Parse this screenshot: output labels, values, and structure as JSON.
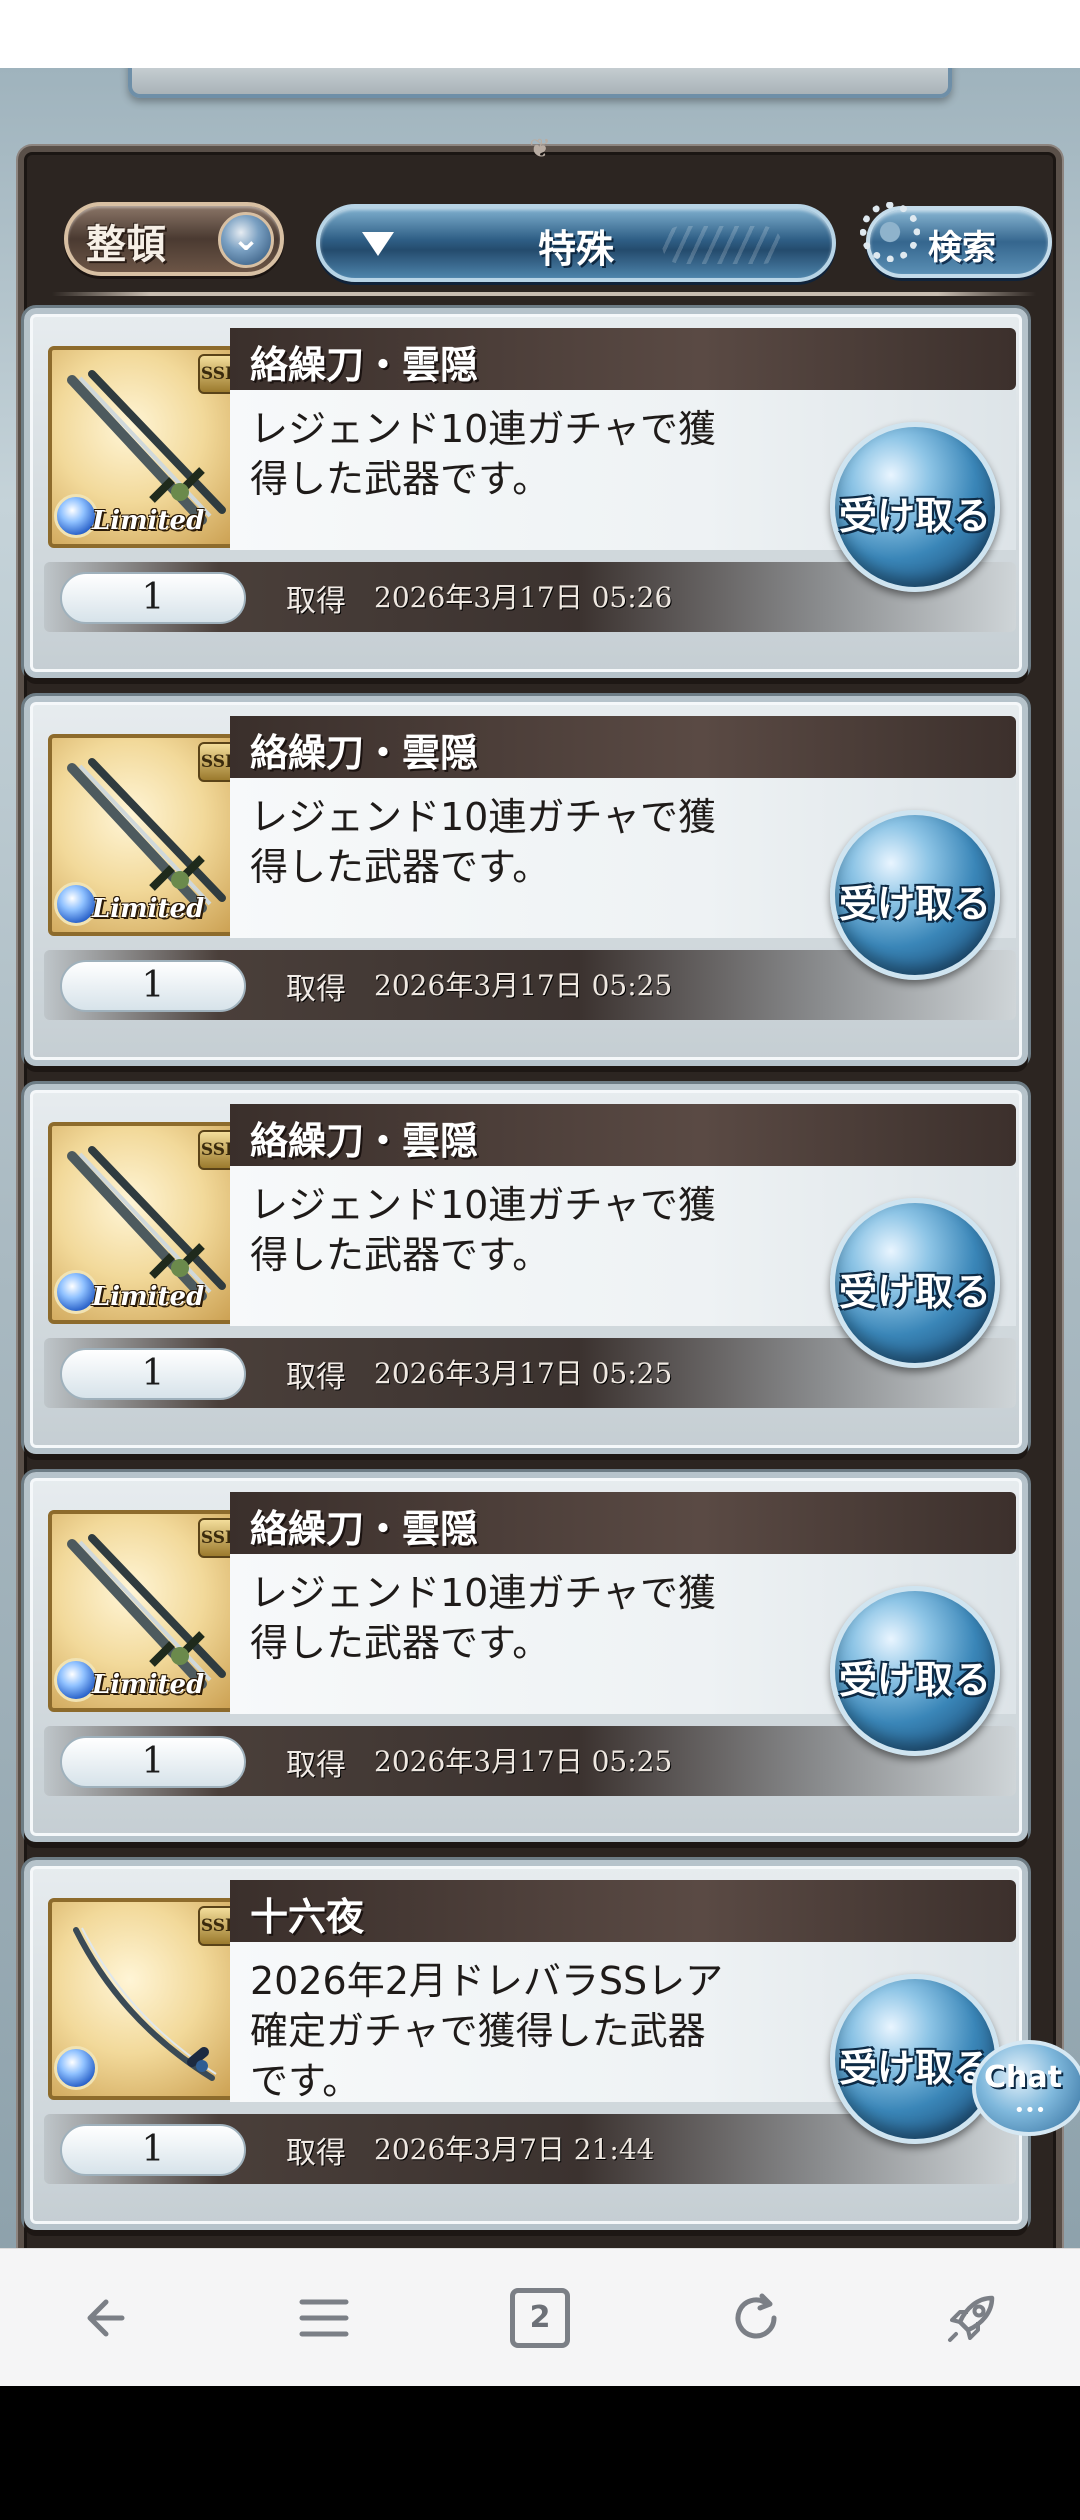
{
  "toolbar": {
    "sort_label": "整頓",
    "filter_label": "特殊",
    "search_label": "検索"
  },
  "items": [
    {
      "name": "絡繰刀・雲隠",
      "description": "レジェンド10連ガチャで獲得した武器です。",
      "quantity": "1",
      "acquired_label": "取得",
      "acquired_date": "2026年3月17日 05:26",
      "rarity": "SSR",
      "limited_label": "Limited",
      "receive_label": "受け取る"
    },
    {
      "name": "絡繰刀・雲隠",
      "description": "レジェンド10連ガチャで獲得した武器です。",
      "quantity": "1",
      "acquired_label": "取得",
      "acquired_date": "2026年3月17日 05:25",
      "rarity": "SSR",
      "limited_label": "Limited",
      "receive_label": "受け取る"
    },
    {
      "name": "絡繰刀・雲隠",
      "description": "レジェンド10連ガチャで獲得した武器です。",
      "quantity": "1",
      "acquired_label": "取得",
      "acquired_date": "2026年3月17日 05:25",
      "rarity": "SSR",
      "limited_label": "Limited",
      "receive_label": "受け取る"
    },
    {
      "name": "絡繰刀・雲隠",
      "description": "レジェンド10連ガチャで獲得した武器です。",
      "quantity": "1",
      "acquired_label": "取得",
      "acquired_date": "2026年3月17日 05:25",
      "rarity": "SSR",
      "limited_label": "Limited",
      "receive_label": "受け取る"
    },
    {
      "name": "十六夜",
      "description": "2026年2月ドレバラSSレア確定ガチャで獲得した武器です。",
      "quantity": "1",
      "acquired_label": "取得",
      "acquired_date": "2026年3月7日 21:44",
      "rarity": "SSR",
      "limited_label": "",
      "receive_label": "受け取る"
    }
  ],
  "chat": {
    "label": "Chat"
  },
  "browser_nav": {
    "back_icon": "arrow-left-icon",
    "menu_icon": "hamburger-menu-icon",
    "tabs_count": "2",
    "reload_icon": "reload-icon",
    "rocket_icon": "rocket-icon"
  },
  "colors": {
    "frame_dark": "#2c2521",
    "button_blue": "#3a86b8",
    "card_bg": "#e7ecef",
    "title_bar": "#3a2f2b"
  }
}
